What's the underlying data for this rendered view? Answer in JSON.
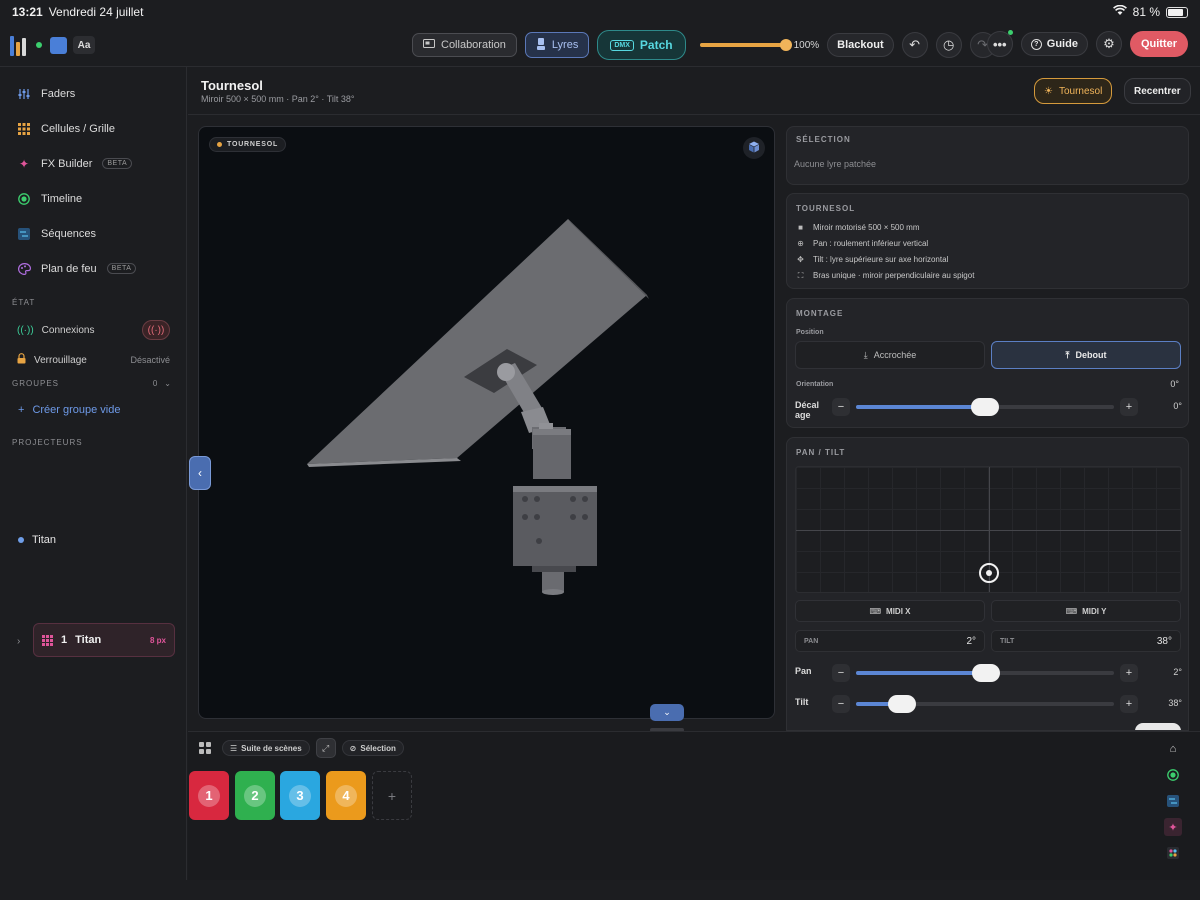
{
  "status_bar": {
    "time": "13:21",
    "date": "Vendredi 24 juillet",
    "battery": "81 %"
  },
  "toolbar": {
    "font_button": "Aa",
    "collaboration": "Collaboration",
    "lyres": "Lyres",
    "dmx_tag": "DMX",
    "patch": "Patch",
    "master_level": 100,
    "master_label": "100%",
    "blackout": "Blackout",
    "guide": "Guide",
    "quit": "Quitter",
    "accent_color": "#e7a443",
    "quit_color": "#e05a64"
  },
  "sidebar": {
    "nav": [
      {
        "label": "Faders",
        "icon": "sliders-icon",
        "beta": ""
      },
      {
        "label": "Cellules / Grille",
        "icon": "grid-icon",
        "beta": ""
      },
      {
        "label": "FX Builder",
        "icon": "sparkle-icon",
        "beta": "BETA"
      },
      {
        "label": "Timeline",
        "icon": "timeline-icon",
        "beta": ""
      },
      {
        "label": "Séquences",
        "icon": "sequence-icon",
        "beta": ""
      },
      {
        "label": "Plan de feu",
        "icon": "palette-icon",
        "beta": "BETA"
      }
    ],
    "state_heading": "ÉTAT",
    "connections": "Connexions",
    "lock": "Verrouillage",
    "lock_value": "Désactivé",
    "groups_heading": "GROUPES",
    "groups_count": "0",
    "create_group": "Créer groupe vide",
    "projectors_heading": "PROJECTEURS",
    "projector": "Titan",
    "card": {
      "number": "1",
      "name": "Titan",
      "size": "8 px"
    }
  },
  "header": {
    "title": "Tournesol",
    "subtitle": "Miroir 500 × 500 mm · Pan 2° · Tilt 38°",
    "sun_button": "Tournesol",
    "recenter": "Recentrer"
  },
  "viewport": {
    "badge": "TOURNESOL"
  },
  "selection": {
    "heading": "SÉLECTION",
    "text": "Aucune lyre patchée"
  },
  "fixture": {
    "heading": "TOURNESOL",
    "features": [
      {
        "icon": "square-icon",
        "text": "Miroir motorisé 500 × 500 mm"
      },
      {
        "icon": "globe-icon",
        "text": "Pan : roulement inférieur vertical"
      },
      {
        "icon": "move-icon",
        "text": "Tilt : lyre supérieure sur axe horizontal"
      },
      {
        "icon": "frame-icon",
        "text": "Bras unique · miroir perpendiculaire au spigot"
      }
    ]
  },
  "mounting": {
    "heading": "MONTAGE",
    "position_label": "Position",
    "hung": "Accrochée",
    "standing": "Debout",
    "orientation_label": "Orientation",
    "orientation_value": "0°",
    "offset_label": "Décal age",
    "offset_value": "0°",
    "offset_level": 0.5
  },
  "pantilt": {
    "heading": "PAN / TILT",
    "pad_x": 0.5,
    "pad_y": 0.85,
    "midi_x": "MIDI X",
    "midi_y": "MIDI Y",
    "pan_label": "PAN",
    "pan_value": "2°",
    "tilt_label": "TILT",
    "tilt_value": "38°",
    "pan_slider_label": "Pan",
    "pan_slider_value": "2°",
    "pan_level": 0.505,
    "tilt_slider_label": "Tilt",
    "tilt_slider_value": "38°",
    "tilt_level": 0.18
  },
  "bottom": {
    "scene_suite": "Suite de scènes",
    "selection": "Sélection",
    "scenes": [
      {
        "label": "1",
        "color": "#d8283f"
      },
      {
        "label": "2",
        "color": "#2fb04f"
      },
      {
        "label": "3",
        "color": "#2aa7e0"
      },
      {
        "label": "4",
        "color": "#eb9a1c"
      }
    ],
    "add": "+"
  }
}
